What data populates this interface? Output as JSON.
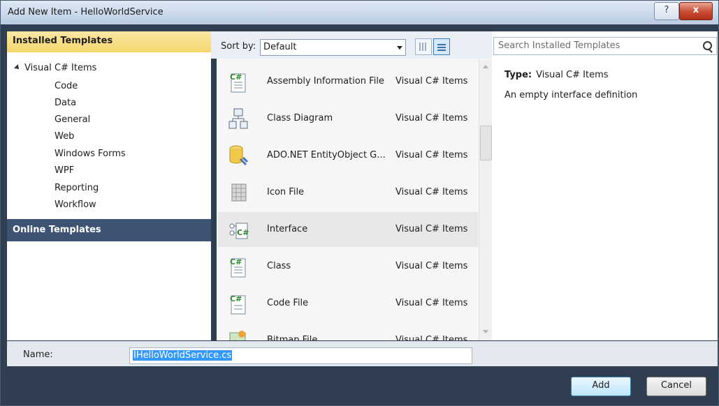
{
  "window": {
    "title": "Add New Item - HelloWorldService",
    "help_glyph": "?",
    "close_glyph": "x"
  },
  "left": {
    "installed_header": "Installed Templates",
    "tree_root": "Visual C# Items",
    "tree_children": [
      "Code",
      "Data",
      "General",
      "Web",
      "Windows Forms",
      "WPF",
      "Reporting",
      "Workflow"
    ],
    "online_header": "Online Templates"
  },
  "sort": {
    "label": "Sort by:",
    "value": "Default"
  },
  "templates": [
    {
      "name": "Assembly Information File",
      "category": "Visual C# Items",
      "icon": "csharp-file-icon"
    },
    {
      "name": "Class Diagram",
      "category": "Visual C# Items",
      "icon": "class-diagram-icon"
    },
    {
      "name": "ADO.NET EntityObject G...",
      "category": "Visual C# Items",
      "icon": "database-icon"
    },
    {
      "name": "Icon File",
      "category": "Visual C# Items",
      "icon": "icon-file-icon"
    },
    {
      "name": "Interface",
      "category": "Visual C# Items",
      "icon": "interface-icon",
      "selected": true
    },
    {
      "name": "Class",
      "category": "Visual C# Items",
      "icon": "csharp-class-icon"
    },
    {
      "name": "Code File",
      "category": "Visual C# Items",
      "icon": "csharp-code-icon"
    },
    {
      "name": "Bitmap File",
      "category": "Visual C# Items",
      "icon": "bitmap-icon"
    }
  ],
  "search": {
    "placeholder": "Search Installed Templates"
  },
  "details": {
    "type_label": "Type:",
    "type_value": "Visual C# Items",
    "description": "An empty interface definition"
  },
  "name_field": {
    "label": "Name:",
    "value": "IHelloWorldService.cs"
  },
  "buttons": {
    "add": "Add",
    "cancel": "Cancel"
  },
  "colors": {
    "accent": "#3e5374",
    "header_gold": "#f6d66e",
    "selection": "#3399ff"
  }
}
